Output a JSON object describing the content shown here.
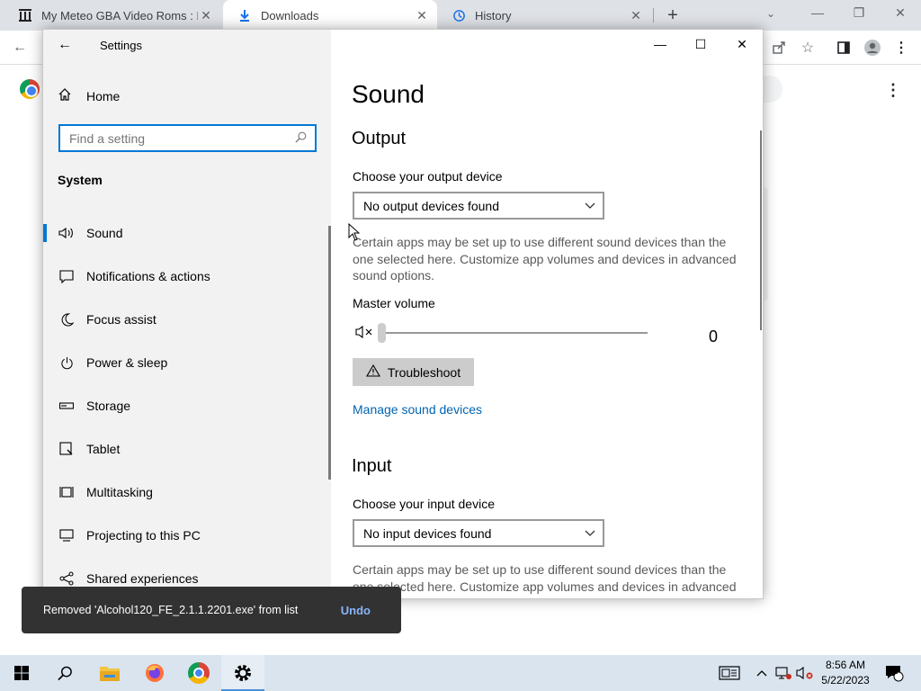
{
  "browser": {
    "tabs": [
      {
        "title": "My Meteo GBA Video Roms : Fre",
        "icon": "archive-icon"
      },
      {
        "title": "Downloads",
        "icon": "download-icon"
      },
      {
        "title": "History",
        "icon": "history-icon"
      }
    ],
    "active_tab": 1
  },
  "settings": {
    "window_title": "Settings",
    "home_label": "Home",
    "search_placeholder": "Find a setting",
    "section": "System",
    "nav": [
      {
        "label": "Sound",
        "icon": "speaker-icon",
        "selected": true
      },
      {
        "label": "Notifications & actions",
        "icon": "notifications-icon"
      },
      {
        "label": "Focus assist",
        "icon": "moon-icon"
      },
      {
        "label": "Power & sleep",
        "icon": "power-icon"
      },
      {
        "label": "Storage",
        "icon": "storage-icon"
      },
      {
        "label": "Tablet",
        "icon": "tablet-icon"
      },
      {
        "label": "Multitasking",
        "icon": "multitasking-icon"
      },
      {
        "label": "Projecting to this PC",
        "icon": "projecting-icon"
      },
      {
        "label": "Shared experiences",
        "icon": "shared-icon"
      }
    ],
    "page_title": "Sound",
    "output": {
      "heading": "Output",
      "device_label": "Choose your output device",
      "device_value": "No output devices found",
      "description": "Certain apps may be set up to use different sound devices than the one selected here. Customize app volumes and devices in advanced sound options.",
      "volume_label": "Master volume",
      "volume_value": "0",
      "troubleshoot": "Troubleshoot",
      "manage_link": "Manage sound devices"
    },
    "input": {
      "heading": "Input",
      "device_label": "Choose your input device",
      "device_value": "No input devices found",
      "description": "Certain apps may be set up to use different sound devices than the one selected here. Customize app volumes and devices in advanced"
    }
  },
  "toast": {
    "message": "Removed 'Alcohol120_FE_2.1.1.2201.exe' from list",
    "action": "Undo"
  },
  "taskbar": {
    "time": "8:56 AM",
    "date": "5/22/2023",
    "notification_count": "1"
  },
  "colors": {
    "accent": "#0078d7",
    "link": "#0063b1",
    "taskbar": "#d9e4ef"
  }
}
